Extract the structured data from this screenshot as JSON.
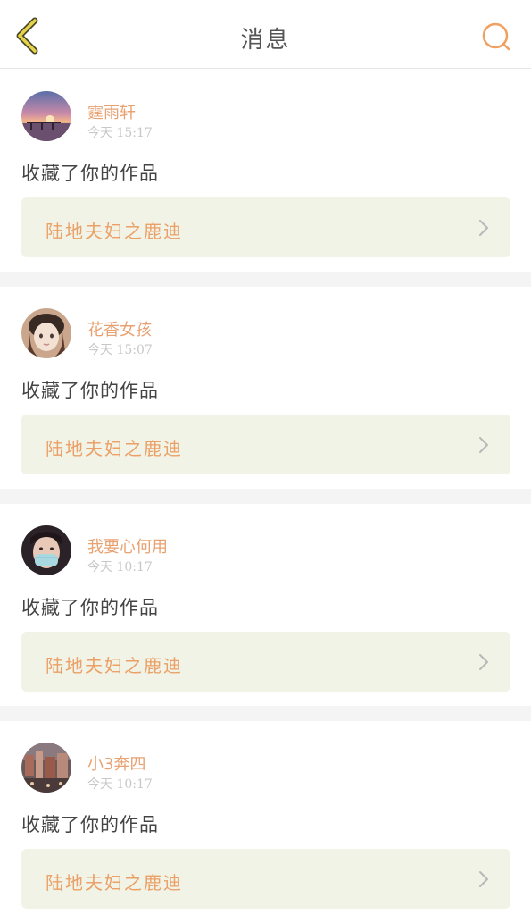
{
  "header": {
    "title": "消息",
    "back_icon": "chevron-left-icon",
    "search_icon": "search-icon",
    "accent_color": "#f0a060"
  },
  "messages": [
    {
      "username": "霆雨轩",
      "time": "今天 15:17",
      "action": "收藏了你的作品",
      "work_title": "陆地夫妇之鹿迪",
      "avatar": "sunset-avatar"
    },
    {
      "username": "花香女孩",
      "time": "今天 15:07",
      "action": "收藏了你的作品",
      "work_title": "陆地夫妇之鹿迪",
      "avatar": "girl-illustration-avatar"
    },
    {
      "username": "我要心何用",
      "time": "今天 10:17",
      "action": "收藏了你的作品",
      "work_title": "陆地夫妇之鹿迪",
      "avatar": "masked-girl-avatar"
    },
    {
      "username": "小3奔四",
      "time": "今天 10:17",
      "action": "收藏了你的作品",
      "work_title": "陆地夫妇之鹿迪",
      "avatar": "city-photo-avatar"
    }
  ]
}
